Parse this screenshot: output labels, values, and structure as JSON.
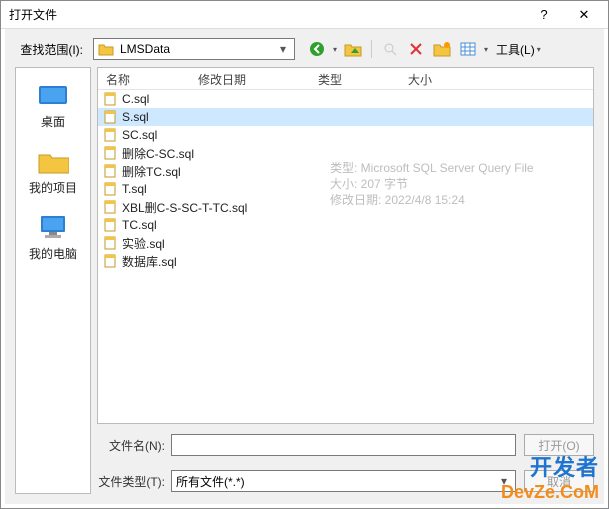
{
  "window": {
    "title": "打开文件",
    "help": "?",
    "close": "✕"
  },
  "lookin": {
    "label": "查找范围(I):",
    "value": "LMSData"
  },
  "tools_label": "工具(L)",
  "headers": {
    "name": "名称",
    "date": "修改日期",
    "type": "类型",
    "size": "大小"
  },
  "places": {
    "desktop": "桌面",
    "projects": "我的项目",
    "computer": "我的电脑"
  },
  "files": [
    {
      "name": "C.sql"
    },
    {
      "name": "S.sql",
      "selected": true
    },
    {
      "name": "SC.sql"
    },
    {
      "name": "删除C-SC.sql"
    },
    {
      "name": "删除TC.sql"
    },
    {
      "name": "T.sql"
    },
    {
      "name": "XBL删C-S-SC-T-TC.sql"
    },
    {
      "name": "TC.sql"
    },
    {
      "name": "实验.sql"
    },
    {
      "name": "数据库.sql"
    }
  ],
  "tooltip": {
    "line1": "类型: Microsoft SQL Server Query File",
    "line2": "大小: 207 字节",
    "line3": "修改日期: 2022/4/8 15:24"
  },
  "filename_label": "文件名(N):",
  "filetype_label": "文件类型(T):",
  "filetype_value": "所有文件(*.*)",
  "open_btn": "打开(O)",
  "cancel_btn": "取消",
  "watermark": {
    "l1": "开发者",
    "l2": "DevZe.CoM"
  }
}
